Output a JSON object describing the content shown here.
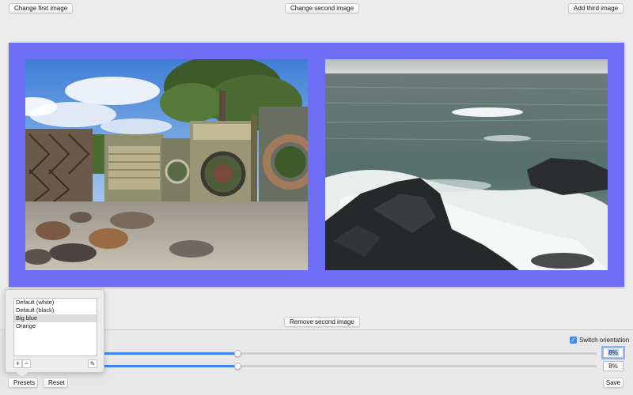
{
  "toolbar": {
    "change_first_label": "Change first image",
    "change_second_label": "Change second image",
    "add_third_label": "Add third image"
  },
  "canvas": {
    "background_color": "#6e6ef7",
    "images": [
      {
        "subject": "garden with wooden doors and circular frames"
      },
      {
        "subject": "ocean waves crashing on dark rocks"
      }
    ]
  },
  "remove_second_label": "Remove second image",
  "presets": {
    "items": [
      {
        "label": "Default (white)",
        "selected": false
      },
      {
        "label": "Default (black)",
        "selected": false
      },
      {
        "label": "Big blue",
        "selected": true
      },
      {
        "label": "Orange",
        "selected": false
      }
    ],
    "add_label": "+",
    "remove_label": "−",
    "edit_icon": "pencil-icon"
  },
  "controls": {
    "switch_orientation_label": "Switch orientation",
    "switch_orientation_checked": true,
    "slider_1": {
      "value_text": "8%",
      "position_fraction": 0.28
    },
    "slider_2": {
      "value_text": "8%",
      "position_fraction": 0.28
    }
  },
  "footer": {
    "presets_label": "Presets",
    "reset_label": "Reset",
    "save_label": "Save"
  },
  "colors": {
    "accent": "#3f86f6",
    "frame": "#6e6ef7"
  }
}
